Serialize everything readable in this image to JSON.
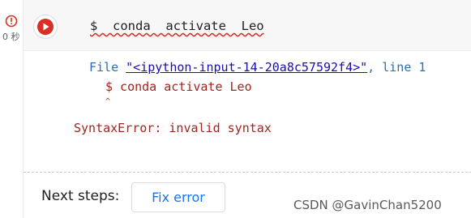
{
  "gutter": {
    "status_icon": "error-circle-icon",
    "exec_time": "0 秒"
  },
  "cell": {
    "run_icon": "play-icon",
    "code": "$  conda  activate  Leo",
    "colors": {
      "run": "#d93025",
      "error_text": "#a0251f",
      "link": "#1a0dab",
      "accent": "#1a73e8"
    }
  },
  "traceback": {
    "file_prefix": "File ",
    "file_link": "\"<ipython-input-14-20a8c57592f4>\"",
    "file_suffix": ", line 1",
    "code_line": "$ conda activate Leo",
    "caret": "^",
    "error": "SyntaxError: invalid syntax"
  },
  "next_steps": {
    "label": "Next steps:",
    "fix_button": "Fix error"
  },
  "watermark": "CSDN @GavinChan5200"
}
